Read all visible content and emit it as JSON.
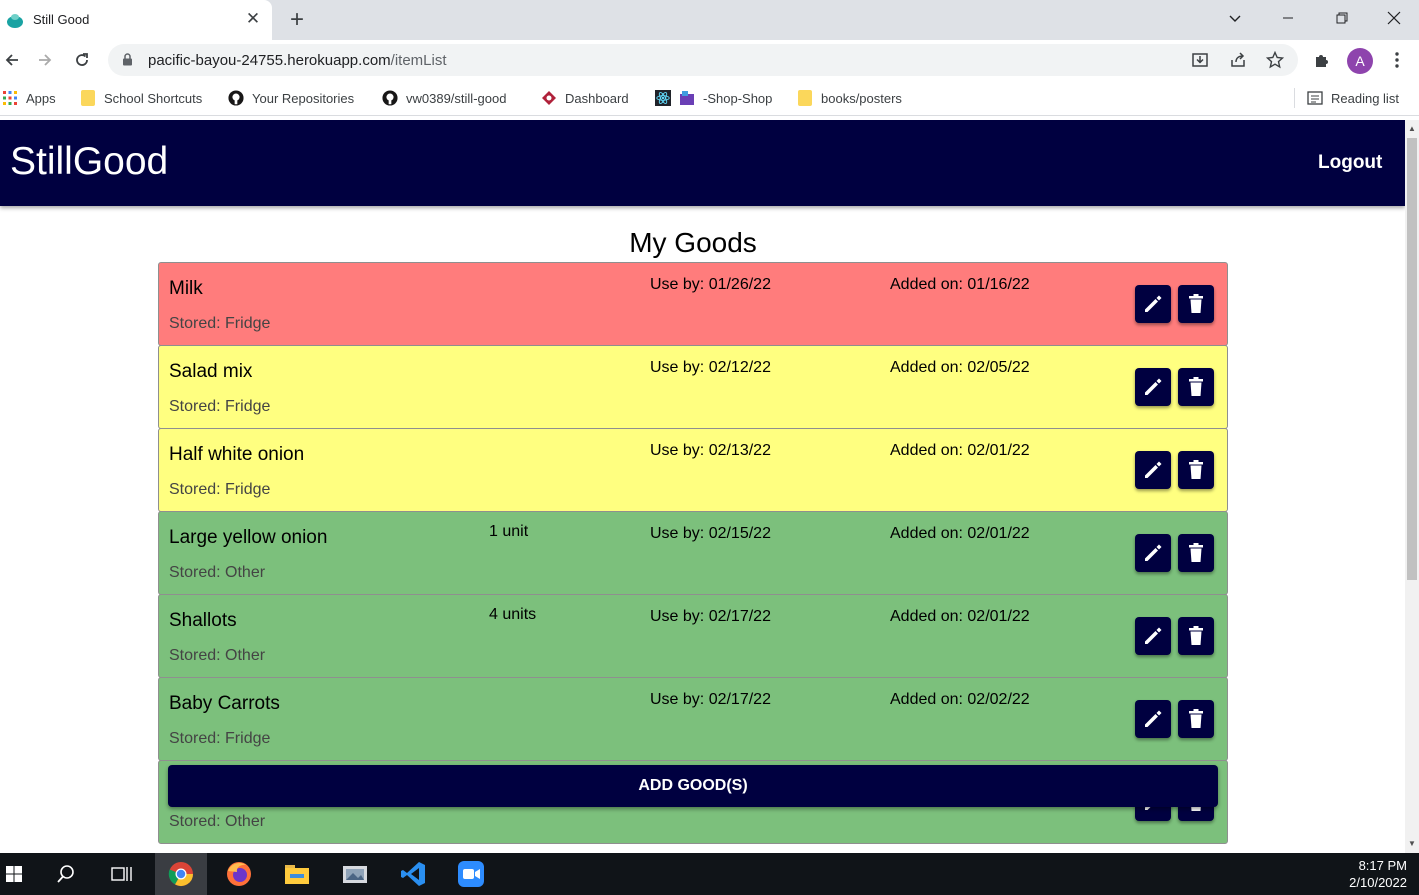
{
  "browser": {
    "tab_title": "Still Good",
    "url_host": "pacific-bayou-24755.herokuapp.com",
    "url_path": "/itemList",
    "avatar_letter": "A",
    "bookmarks": [
      {
        "label": "Apps",
        "icon": "apps-grid-icon"
      },
      {
        "label": "School Shortcuts",
        "icon": "folder-icon"
      },
      {
        "label": "Your Repositories",
        "icon": "github-icon"
      },
      {
        "label": "vw0389/still-good",
        "icon": "github-icon"
      },
      {
        "label": "Dashboard",
        "icon": "dashboard-icon"
      },
      {
        "label": "-Shop-Shop",
        "icon": "react-icon"
      },
      {
        "label": "books/posters",
        "icon": "folder-icon"
      }
    ],
    "reading_list": "Reading list"
  },
  "app": {
    "brand": "StillGood",
    "logout": "Logout",
    "page_title": "My Goods",
    "add_button": "ADD GOOD(S)",
    "status_colors": {
      "expired": "#ff7c7c",
      "soon": "#ffff80",
      "fresh": "#7cc07c"
    },
    "items": [
      {
        "name": "Milk",
        "stored": "Stored: Fridge",
        "qty": "",
        "use_by": "Use by: 01/26/22",
        "added": "Added on: 01/16/22",
        "status": "red"
      },
      {
        "name": "Salad mix",
        "stored": "Stored: Fridge",
        "qty": "",
        "use_by": "Use by: 02/12/22",
        "added": "Added on: 02/05/22",
        "status": "yellow"
      },
      {
        "name": "Half white onion",
        "stored": "Stored: Fridge",
        "qty": "",
        "use_by": "Use by: 02/13/22",
        "added": "Added on: 02/01/22",
        "status": "yellow"
      },
      {
        "name": "Large yellow onion",
        "stored": "Stored: Other",
        "qty": "1 unit",
        "use_by": "Use by: 02/15/22",
        "added": "Added on: 02/01/22",
        "status": "green"
      },
      {
        "name": "Shallots",
        "stored": "Stored: Other",
        "qty": "4 units",
        "use_by": "Use by: 02/17/22",
        "added": "Added on: 02/01/22",
        "status": "green"
      },
      {
        "name": "Baby Carrots",
        "stored": "Stored: Fridge",
        "qty": "",
        "use_by": "Use by: 02/17/22",
        "added": "Added on: 02/02/22",
        "status": "green"
      },
      {
        "name": "",
        "stored": "Stored: Other",
        "qty": "",
        "use_by": "",
        "added": "",
        "status": "green"
      }
    ]
  },
  "taskbar": {
    "time": "8:17 PM",
    "date": "2/10/2022"
  }
}
